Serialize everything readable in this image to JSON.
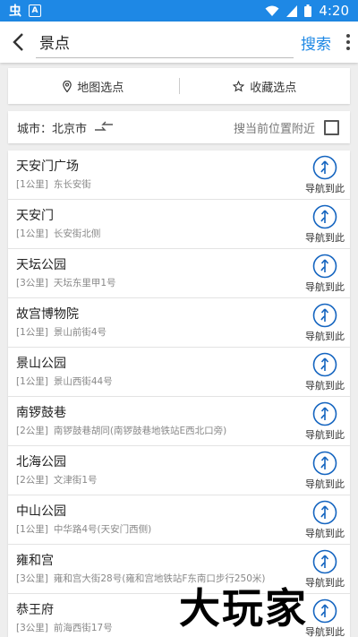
{
  "status_bar": {
    "icons": [
      "app-notification-icon",
      "a-icon"
    ],
    "time": "4:20"
  },
  "search": {
    "value": "景点",
    "button_label": "搜索"
  },
  "select_options": {
    "map_select": "地图选点",
    "favorite_select": "收藏选点"
  },
  "city": {
    "label": "城市：北京市",
    "nearby_label": "搜当前位置附近",
    "nearby_checked": false
  },
  "nav_label": "导航到此",
  "results": [
    {
      "name": "天安门广场",
      "distance": "[1公里]",
      "address": "东长安街"
    },
    {
      "name": "天安门",
      "distance": "[1公里]",
      "address": "长安街北侧"
    },
    {
      "name": "天坛公园",
      "distance": "[3公里]",
      "address": "天坛东里甲1号"
    },
    {
      "name": "故宫博物院",
      "distance": "[1公里]",
      "address": "景山前街4号"
    },
    {
      "name": "景山公园",
      "distance": "[1公里]",
      "address": "景山西街44号"
    },
    {
      "name": "南锣鼓巷",
      "distance": "[2公里]",
      "address": "南锣鼓巷胡同(南锣鼓巷地铁站E西北口旁)"
    },
    {
      "name": "北海公园",
      "distance": "[2公里]",
      "address": "文津街1号"
    },
    {
      "name": "中山公园",
      "distance": "[1公里]",
      "address": "中华路4号(天安门西侧)"
    },
    {
      "name": "雍和宫",
      "distance": "[3公里]",
      "address": "雍和宫大街28号(雍和宫地铁站F东南口步行250米)"
    },
    {
      "name": "恭王府",
      "distance": "[3公里]",
      "address": "前海西街17号"
    }
  ],
  "watermark": "大玩家",
  "colors": {
    "accent": "#1e88e5",
    "nav_icon": "#1565c0"
  }
}
